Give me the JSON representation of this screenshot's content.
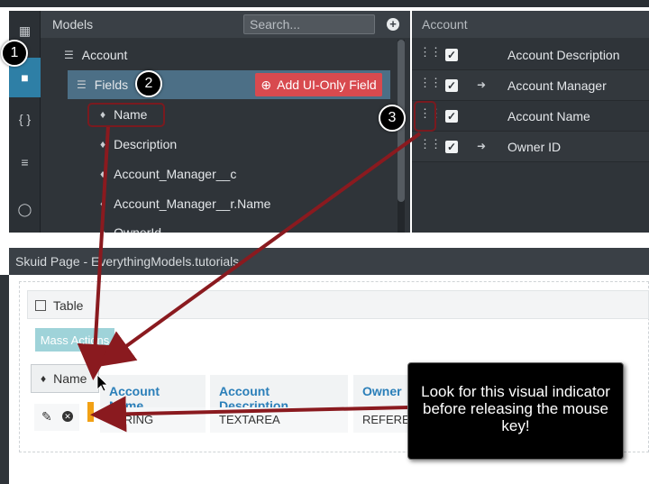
{
  "models_panel": {
    "title": "Models",
    "search_placeholder": "Search...",
    "add_label": "+",
    "tree": {
      "account_label": "Account",
      "fields_label": "Fields",
      "add_field_button": "Add UI-Only Field",
      "fields": [
        "Name",
        "Description",
        "Account_Manager__c",
        "Account_Manager__r.Name",
        "OwnerId"
      ]
    }
  },
  "account_panel": {
    "title": "Account",
    "rows": [
      {
        "label": "Account Description",
        "ref": false
      },
      {
        "label": "Account Manager",
        "ref": true
      },
      {
        "label": "Account Name",
        "ref": false
      },
      {
        "label": "Owner ID",
        "ref": true
      }
    ]
  },
  "page": {
    "title": "Skuid Page - EverythingModels.tutorials",
    "table_label": "Table",
    "mass_actions_label": "Mass Actions",
    "dragged_chip_label": "Name",
    "columns": [
      {
        "header": "Account Name",
        "cell": "STRING"
      },
      {
        "header": "Account Description",
        "cell": "TEXTAREA"
      },
      {
        "header": "Owner",
        "cell": "REFEREN"
      }
    ]
  },
  "tooltip": {
    "text": "Look for this visual indicator before releasing the mouse key!"
  },
  "callouts": [
    "1",
    "2",
    "3"
  ],
  "colors": {
    "rail_active": "#2e7fa6",
    "add_field_button": "#d84a4f",
    "drop_indicator": "#f2a115",
    "column_header_text": "#2b7fb9",
    "arrow": "#8a1a1f"
  },
  "icons": {
    "rail": [
      "cube-icon",
      "model-icon",
      "braces-icon",
      "css-icon",
      "globe-icon"
    ],
    "tree_account": "database-icon",
    "tree_fields": "list-icon",
    "field": "tag-icon"
  }
}
